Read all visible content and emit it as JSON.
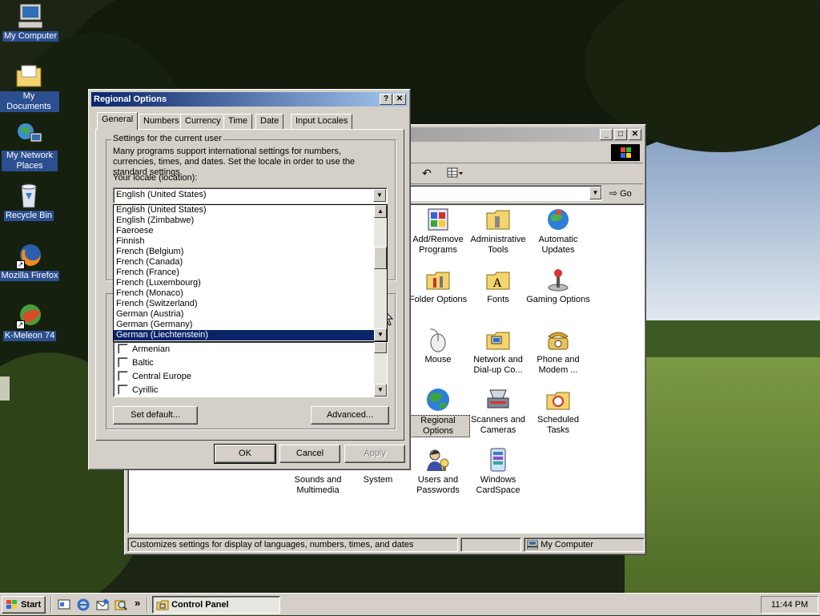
{
  "desktop": {
    "icons": [
      {
        "label": "My Computer"
      },
      {
        "label": "My Documents"
      },
      {
        "label": "My Network Places"
      },
      {
        "label": "Recycle Bin"
      },
      {
        "label": "Mozilla Firefox"
      },
      {
        "label": "K-Meleon 74"
      }
    ]
  },
  "control_panel": {
    "go_label": "Go",
    "items": [
      {
        "label": "Add/Remove Programs"
      },
      {
        "label": "Administrative Tools"
      },
      {
        "label": "Automatic Updates"
      },
      {
        "label": "Folder Options"
      },
      {
        "label": "Fonts"
      },
      {
        "label": "Gaming Options"
      },
      {
        "label": "Mouse"
      },
      {
        "label": "Network and Dial-up Co..."
      },
      {
        "label": "Phone and Modem ..."
      },
      {
        "label": "Regional Options"
      },
      {
        "label": "Scanners and Cameras"
      },
      {
        "label": "Scheduled Tasks"
      },
      {
        "label": "Sounds and Multimedia"
      },
      {
        "label": "System"
      },
      {
        "label": "Users and Passwords"
      },
      {
        "label": "Windows CardSpace"
      }
    ],
    "status_text": "Customizes settings for display of languages, numbers, times, and dates",
    "status_zone": "My Computer"
  },
  "dialog": {
    "title": "Regional Options",
    "help_label": "?",
    "close_label": "✕",
    "tabs": [
      {
        "label": "General"
      },
      {
        "label": "Numbers"
      },
      {
        "label": "Currency"
      },
      {
        "label": "Time"
      },
      {
        "label": "Date"
      },
      {
        "label": "Input Locales"
      }
    ],
    "group_title": "Settings for the current user",
    "description": "Many programs support international settings for numbers, currencies, times, and dates. Set the locale in order to use the standard settings.",
    "locale_label": "Your locale (location):",
    "locale_selected": "English (United States)",
    "locale_options": [
      "English (United States)",
      "English (Zimbabwe)",
      "Faeroese",
      "Finnish",
      "French (Belgium)",
      "French (Canada)",
      "French (France)",
      "French (Luxembourg)",
      "French (Monaco)",
      "French (Switzerland)",
      "German (Austria)",
      "German (Germany)",
      "German (Liechtenstein)"
    ],
    "highlighted_option": "German (Liechtenstein)",
    "language_settings": [
      "Armenian",
      "Baltic",
      "Central Europe",
      "Cyrillic"
    ],
    "set_default_label": "Set default...",
    "advanced_label": "Advanced...",
    "ok_label": "OK",
    "cancel_label": "Cancel",
    "apply_label": "Apply"
  },
  "taskbar": {
    "start_label": "Start",
    "task_label": "Control Panel",
    "quicklaunch_more": "»",
    "clock": "11:44 PM"
  },
  "colors": {
    "title_active": "#0a246a",
    "title_active_end": "#a6caf0",
    "title_inactive": "#808080",
    "selection": "#0a246a",
    "face": "#d4d0c8"
  }
}
